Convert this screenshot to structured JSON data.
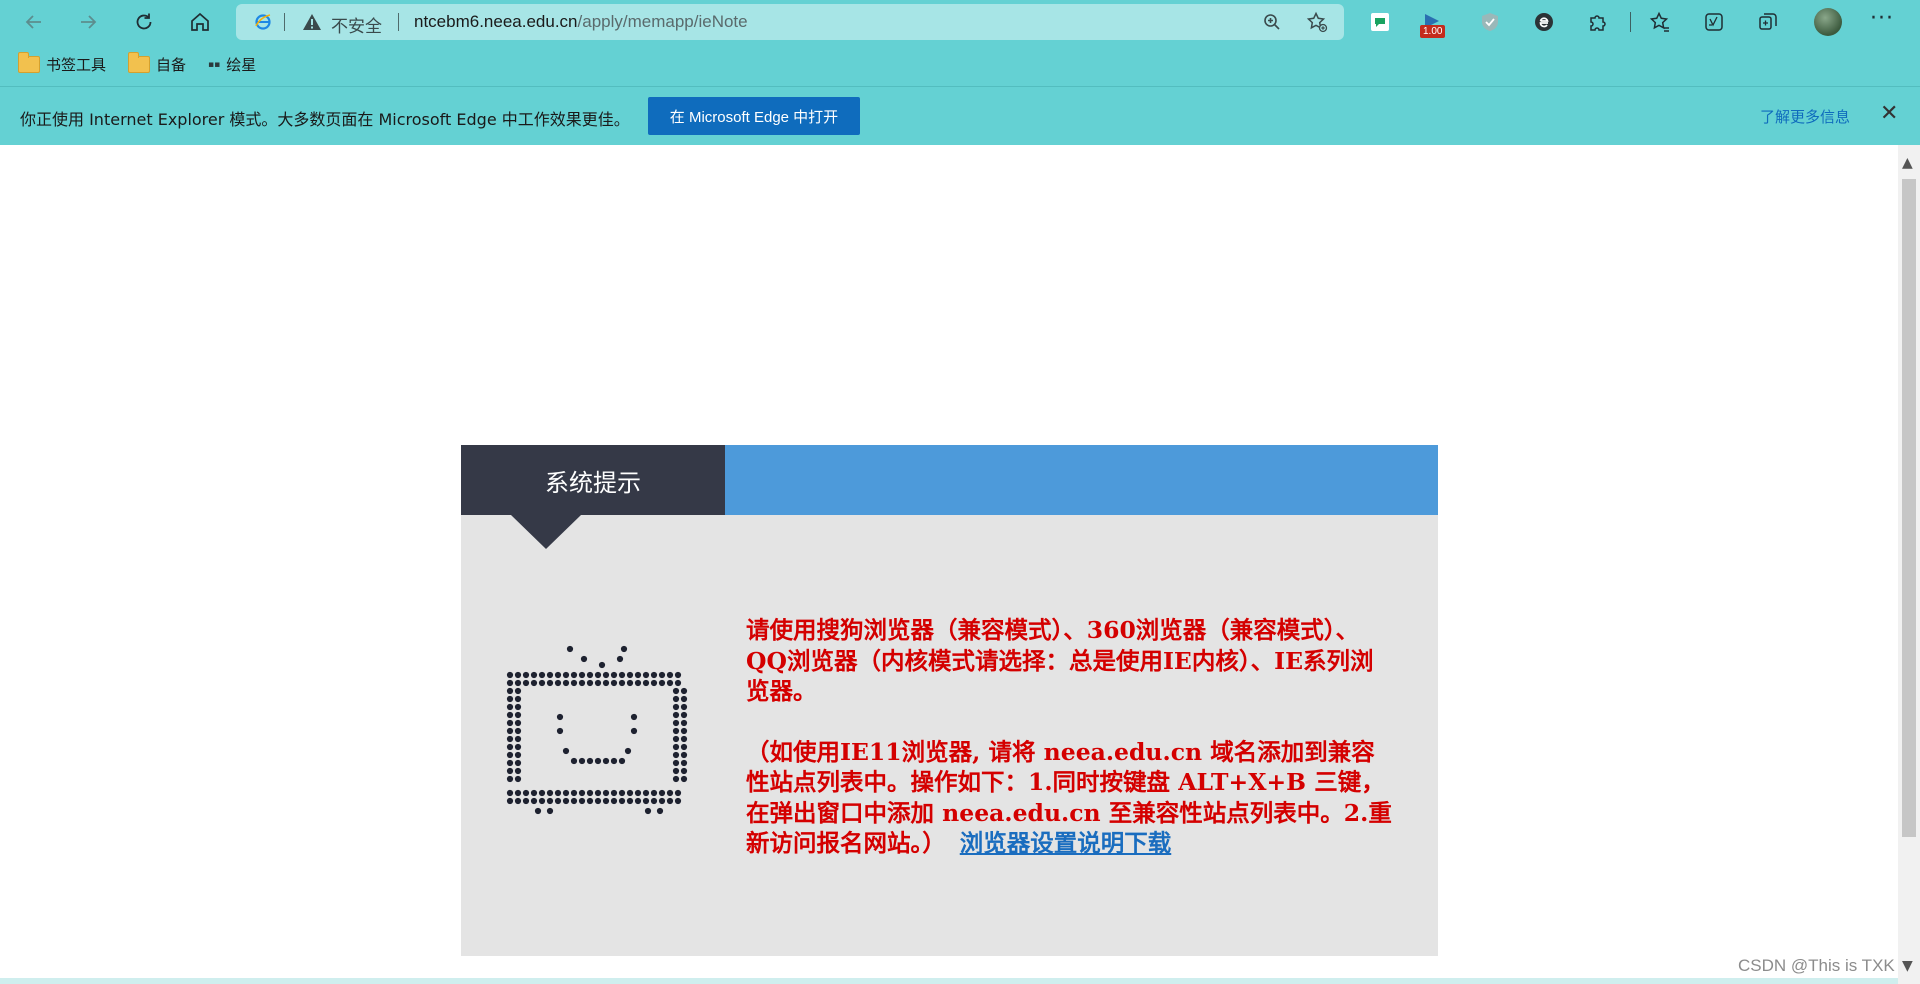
{
  "browser": {
    "security_label": "不安全",
    "url_host": "ntcebm6.neea.edu.cn",
    "url_path": "/apply/memapp/ieNote",
    "extension_badge": "1.00",
    "bookmarks": [
      {
        "label": "书签工具",
        "icon": "folder-icon"
      },
      {
        "label": "自备",
        "icon": "folder-icon"
      },
      {
        "label": "绘星",
        "icon": "site-icon"
      }
    ]
  },
  "ie_mode_bar": {
    "message": "你正使用 Internet Explorer 模式。大多数页面在 Microsoft Edge 中工作效果更佳。",
    "open_button": "在 Microsoft Edge 中打开",
    "learn_more": "了解更多信息"
  },
  "notice_panel": {
    "title": "系统提示",
    "paragraph1": "请使用搜狗浏览器（兼容模式）、360浏览器（兼容模式）、QQ浏览器（内核模式请选择：总是使用IE内核）、IE系列浏览器。",
    "paragraph2": "（如使用IE11浏览器, 请将 neea.edu.cn 域名添加到兼容性站点列表中。操作如下：1.同时按键盘 ALT+X+B 三键，在弹出窗口中添加 neea.edu.cn 至兼容性站点列表中。2.重新访问报名网站。）",
    "download_link": "浏览器设置说明下载"
  },
  "watermark": "CSDN @This is TXK",
  "colors": {
    "chrome": "#64d1d3",
    "header_blue": "#4d9ada",
    "title_dark": "#353947",
    "panel_bg": "#e4e4e4",
    "notice_red": "#d40000",
    "link_blue": "#1a6dbf",
    "button_blue": "#0f6cbd"
  }
}
